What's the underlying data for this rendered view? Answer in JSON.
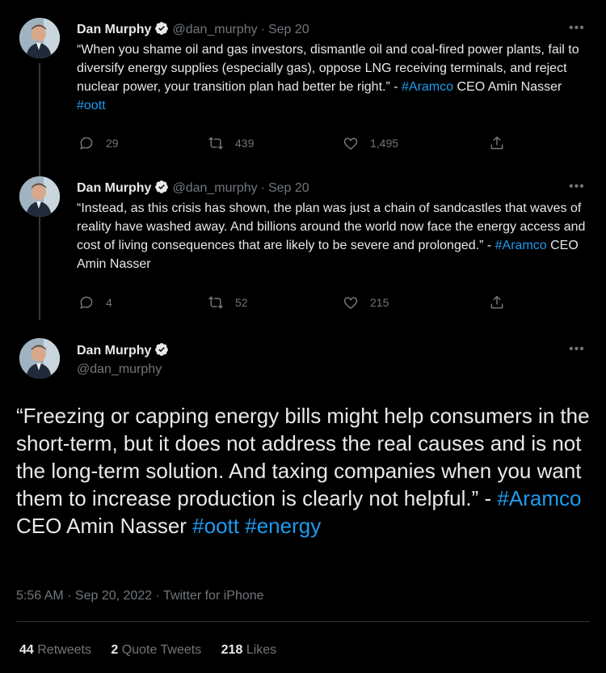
{
  "author": {
    "name": "Dan Murphy",
    "handle": "@dan_murphy"
  },
  "tweet1": {
    "date": "Sep 20",
    "text_a": "“When you shame oil and gas investors, dismantle oil and coal-fired power plants, fail to diversify energy supplies (especially gas), oppose LNG receiving terminals, and reject nuclear power, your transition plan had better be right.” - ",
    "tag1": "#Aramco",
    "text_b": " CEO Amin Nasser ",
    "tag2": "#oott",
    "replies": "29",
    "retweets": "439",
    "likes": "1,495"
  },
  "tweet2": {
    "date": "Sep 20",
    "text_a": "“Instead, as this crisis has shown, the plan was just a chain of sandcastles that waves of reality have washed away. And billions around the world now face the energy access and cost of living consequences that are likely to be severe and prolonged.” - ",
    "tag1": "#Aramco",
    "text_b": " CEO Amin Nasser",
    "replies": "4",
    "retweets": "52",
    "likes": "215"
  },
  "main_tweet": {
    "text_a": "“Freezing or capping energy bills might help consumers in the short-term, but it does not address the real causes and is not the long-term solution. And taxing companies when you want them to increase production is clearly not helpful.” - ",
    "tag1": "#Aramco",
    "text_b": " CEO Amin Nasser ",
    "tag2": "#oott",
    "tag3": "#energy",
    "timestamp": "5:56 AM · Sep 20, 2022 · Twitter for iPhone",
    "retweets_count": "44",
    "retweets_label": "Retweets",
    "quotes_count": "2",
    "quotes_label": "Quote Tweets",
    "likes_count": "218",
    "likes_label": "Likes"
  },
  "ui": {
    "dot_sep": "·",
    "more": "•••"
  },
  "icons": [
    "reply-icon",
    "retweet-icon",
    "like-icon",
    "share-icon",
    "verified-badge-icon",
    "more-icon"
  ],
  "colors": {
    "background": "#000000",
    "text": "#e7e9ea",
    "muted": "#71767b",
    "link": "#1d9bf0"
  }
}
